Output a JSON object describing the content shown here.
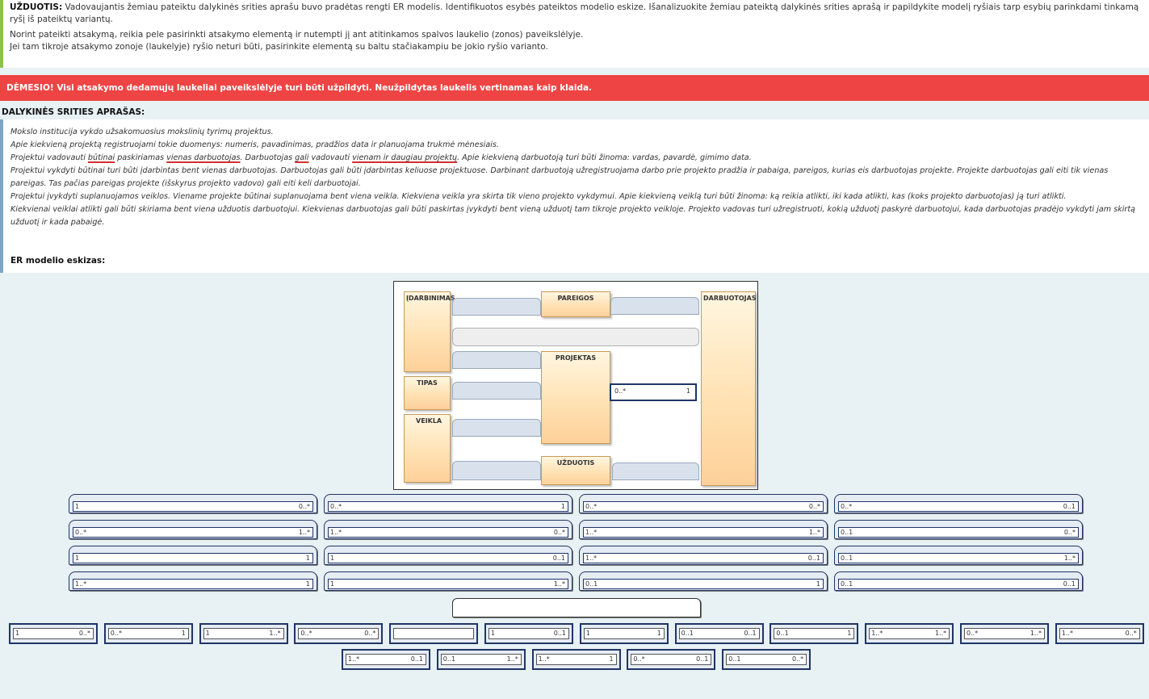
{
  "task": {
    "label": "UŽDUOTIS:",
    "text": " Vadovaujantis žemiau pateiktu dalykinės srities aprašu buvo pradėtas rengti ER modelis. Identifikuotos esybės pateiktos modelio eskize. Išanalizuokite žemiau pateiktą dalykinės srities aprašą ir papildykite modelį ryšiais tarp esybių parinkdami tinkamą ryšį iš pateiktų variantų.",
    "line2": "Norint pateikti atsakymą, reikia pele pasirinkti atsakymo elementą ir nutempti jį ant atitinkamos spalvos laukelio (zonos) paveikslėlyje.",
    "line3": "Jei tam tikroje atsakymo zonoje (laukelyje) ryšio neturi būti, pasirinkite elementą su baltu stačiakampiu be jokio ryšio varianto."
  },
  "warning": "DĖMESIO! Visi atsakymo dedamųjų laukeliai paveikslėlyje turi būti užpildyti. Neužpildytas laukelis vertinamas kaip klaida.",
  "section_title": "DALYKINĖS SRITIES APRAŠAS:",
  "desc": {
    "l1": "Mokslo institucija vykdo užsakomuosius mokslinių tyrimų projektus.",
    "l2": "Apie kiekvieną projektą registruojami tokie duomenys: numeris, pavadinimas, pradžios data ir planuojama trukmė mėnesiais.",
    "l3a": "Projektui vadovauti ",
    "l3b": "būtinai",
    "l3c": " paskiriamas ",
    "l3d": "vienas darbuotojas",
    "l3e": ". Darbuotojas ",
    "l3f": "gali",
    "l3g": " vadovauti ",
    "l3h": "vienam ir daugiau projektų",
    "l3i": ". Apie kiekvieną darbuotoją turi būti žinoma: vardas, pavardė, gimimo data.",
    "l4": "Projektui vykdyti būtinai turi būti įdarbintas bent vienas darbuotojas. Darbuotojas gali būti įdarbintas keliuose projektuose. Darbinant darbuotoją užregistruojama darbo prie projekto pradžia ir pabaiga, pareigos, kurias eis darbuotojas projekte. Projekte darbuotojas gali eiti tik vienas pareigas. Tas pačias pareigas projekte (išskyrus projekto vadovo) gali eiti keli darbuotojai.",
    "l5": "Projektui įvykdyti suplanuojamos veiklos. Viename projekte būtinai suplanuojama bent viena veikla. Kiekviena veikla yra skirta tik vieno projekto vykdymui. Apie kiekvieną veiklą turi būti žinoma: ką reikia atlikti, iki kada atlikti, kas (koks projekto darbuotojas) ją turi atlikti.",
    "l6": "Kiekvienai veiklai atlikti gali būti skiriama bent viena užduotis darbuotojui. Kiekvienas darbuotojas gali būti paskirtas įvykdyti bent vieną užduotį tam tikroje projekto veikloje. Projekto vadovas turi užregistruoti, kokią užduotį paskyrė darbuotojui, kada darbuotojas pradėjo vykdyti jam skirtą užduotį ir kada pabaigė."
  },
  "er_title": "ER modelio eskizas:",
  "entities": {
    "idarbinimas": "ĮDARBINIMAS",
    "pareigos": "PAREIGOS",
    "darbuotojas": "DARBUOTOJAS",
    "projektas": "PROJEKTAS",
    "tipas": "TIPAS",
    "veikla": "VEIKLA",
    "uzduotis": "UŽDUOTIS"
  },
  "placed": {
    "l": "0..*",
    "r": "1"
  },
  "options_row1": [
    {
      "l": "1",
      "r": "0..*"
    },
    {
      "l": "0..*",
      "r": "1"
    },
    {
      "l": "0..*",
      "r": "0..*"
    },
    {
      "l": "0..*",
      "r": "0..1"
    }
  ],
  "options_row2": [
    {
      "l": "0..*",
      "r": "1..*"
    },
    {
      "l": "1..*",
      "r": "0..*"
    },
    {
      "l": "1..*",
      "r": "1..*"
    },
    {
      "l": "0..1",
      "r": "0..*"
    }
  ],
  "options_row3": [
    {
      "l": "1",
      "r": "1"
    },
    {
      "l": "1",
      "r": "0..1"
    },
    {
      "l": "1..*",
      "r": "0..1"
    },
    {
      "l": "0..1",
      "r": "1..*"
    }
  ],
  "options_row4": [
    {
      "l": "1..*",
      "r": "1"
    },
    {
      "l": "1",
      "r": "1..*"
    },
    {
      "l": "0..1",
      "r": "1"
    },
    {
      "l": "0..1",
      "r": "0..1"
    }
  ],
  "small_row1": [
    {
      "l": "1",
      "r": "0..*"
    },
    {
      "l": "0..*",
      "r": "1"
    },
    {
      "l": "1",
      "r": "1..*"
    },
    {
      "l": "0..*",
      "r": "0..*"
    },
    {
      "l": "",
      "r": ""
    },
    {
      "l": "1",
      "r": "0..1"
    },
    {
      "l": "1",
      "r": "1"
    },
    {
      "l": "0..1",
      "r": "0..1"
    },
    {
      "l": "0..1",
      "r": "1"
    },
    {
      "l": "1..*",
      "r": "1..*"
    },
    {
      "l": "0..*",
      "r": "1..*"
    },
    {
      "l": "1..*",
      "r": "0..*"
    }
  ],
  "small_row2": [
    {
      "l": "1..*",
      "r": "0..1"
    },
    {
      "l": "0..1",
      "r": "1..*"
    },
    {
      "l": "1..*",
      "r": "1"
    },
    {
      "l": "0..*",
      "r": "0..1"
    },
    {
      "l": "0..1",
      "r": "0..*"
    }
  ]
}
